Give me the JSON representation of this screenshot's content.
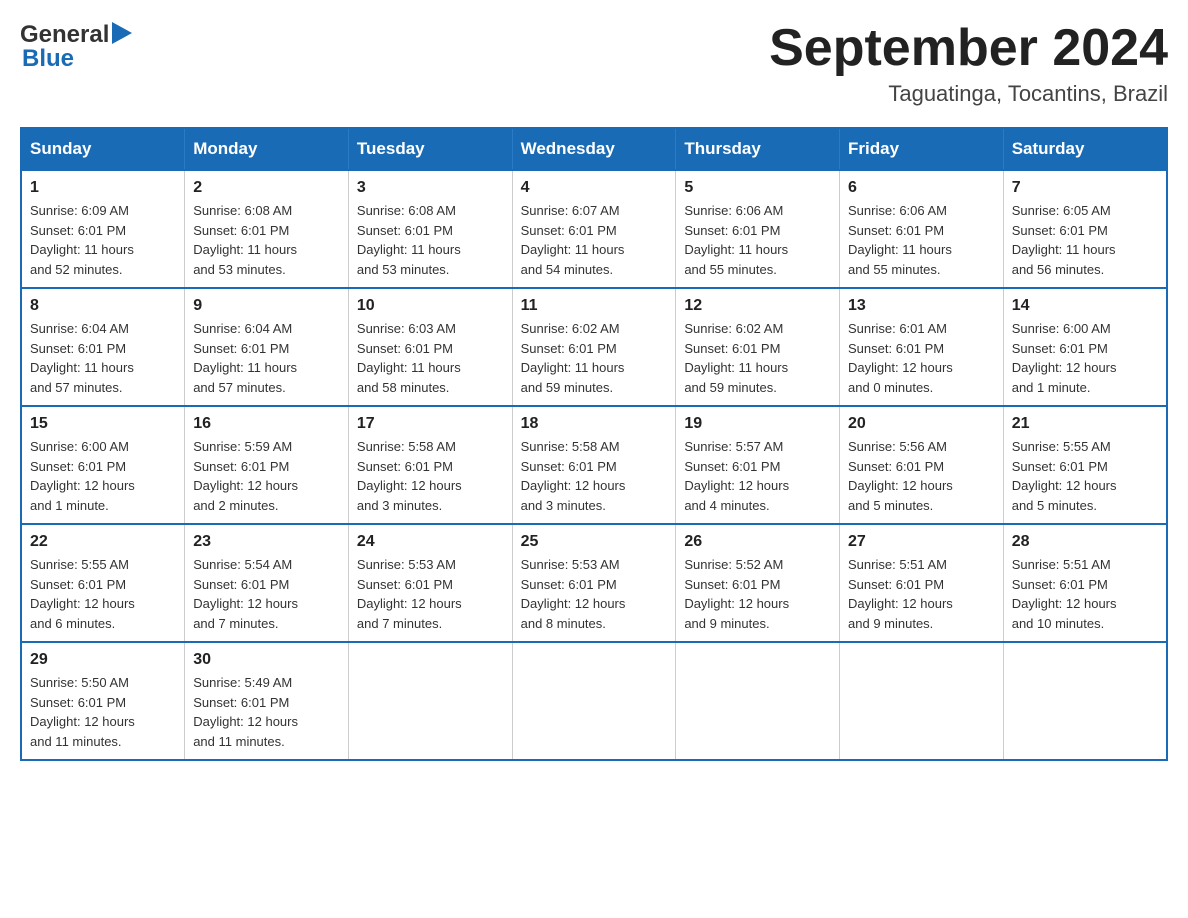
{
  "logo": {
    "text_general": "General",
    "triangle": "▶",
    "text_blue": "Blue"
  },
  "title": "September 2024",
  "subtitle": "Taguatinga, Tocantins, Brazil",
  "headers": [
    "Sunday",
    "Monday",
    "Tuesday",
    "Wednesday",
    "Thursday",
    "Friday",
    "Saturday"
  ],
  "weeks": [
    [
      {
        "day": "1",
        "info": "Sunrise: 6:09 AM\nSunset: 6:01 PM\nDaylight: 11 hours\nand 52 minutes."
      },
      {
        "day": "2",
        "info": "Sunrise: 6:08 AM\nSunset: 6:01 PM\nDaylight: 11 hours\nand 53 minutes."
      },
      {
        "day": "3",
        "info": "Sunrise: 6:08 AM\nSunset: 6:01 PM\nDaylight: 11 hours\nand 53 minutes."
      },
      {
        "day": "4",
        "info": "Sunrise: 6:07 AM\nSunset: 6:01 PM\nDaylight: 11 hours\nand 54 minutes."
      },
      {
        "day": "5",
        "info": "Sunrise: 6:06 AM\nSunset: 6:01 PM\nDaylight: 11 hours\nand 55 minutes."
      },
      {
        "day": "6",
        "info": "Sunrise: 6:06 AM\nSunset: 6:01 PM\nDaylight: 11 hours\nand 55 minutes."
      },
      {
        "day": "7",
        "info": "Sunrise: 6:05 AM\nSunset: 6:01 PM\nDaylight: 11 hours\nand 56 minutes."
      }
    ],
    [
      {
        "day": "8",
        "info": "Sunrise: 6:04 AM\nSunset: 6:01 PM\nDaylight: 11 hours\nand 57 minutes."
      },
      {
        "day": "9",
        "info": "Sunrise: 6:04 AM\nSunset: 6:01 PM\nDaylight: 11 hours\nand 57 minutes."
      },
      {
        "day": "10",
        "info": "Sunrise: 6:03 AM\nSunset: 6:01 PM\nDaylight: 11 hours\nand 58 minutes."
      },
      {
        "day": "11",
        "info": "Sunrise: 6:02 AM\nSunset: 6:01 PM\nDaylight: 11 hours\nand 59 minutes."
      },
      {
        "day": "12",
        "info": "Sunrise: 6:02 AM\nSunset: 6:01 PM\nDaylight: 11 hours\nand 59 minutes."
      },
      {
        "day": "13",
        "info": "Sunrise: 6:01 AM\nSunset: 6:01 PM\nDaylight: 12 hours\nand 0 minutes."
      },
      {
        "day": "14",
        "info": "Sunrise: 6:00 AM\nSunset: 6:01 PM\nDaylight: 12 hours\nand 1 minute."
      }
    ],
    [
      {
        "day": "15",
        "info": "Sunrise: 6:00 AM\nSunset: 6:01 PM\nDaylight: 12 hours\nand 1 minute."
      },
      {
        "day": "16",
        "info": "Sunrise: 5:59 AM\nSunset: 6:01 PM\nDaylight: 12 hours\nand 2 minutes."
      },
      {
        "day": "17",
        "info": "Sunrise: 5:58 AM\nSunset: 6:01 PM\nDaylight: 12 hours\nand 3 minutes."
      },
      {
        "day": "18",
        "info": "Sunrise: 5:58 AM\nSunset: 6:01 PM\nDaylight: 12 hours\nand 3 minutes."
      },
      {
        "day": "19",
        "info": "Sunrise: 5:57 AM\nSunset: 6:01 PM\nDaylight: 12 hours\nand 4 minutes."
      },
      {
        "day": "20",
        "info": "Sunrise: 5:56 AM\nSunset: 6:01 PM\nDaylight: 12 hours\nand 5 minutes."
      },
      {
        "day": "21",
        "info": "Sunrise: 5:55 AM\nSunset: 6:01 PM\nDaylight: 12 hours\nand 5 minutes."
      }
    ],
    [
      {
        "day": "22",
        "info": "Sunrise: 5:55 AM\nSunset: 6:01 PM\nDaylight: 12 hours\nand 6 minutes."
      },
      {
        "day": "23",
        "info": "Sunrise: 5:54 AM\nSunset: 6:01 PM\nDaylight: 12 hours\nand 7 minutes."
      },
      {
        "day": "24",
        "info": "Sunrise: 5:53 AM\nSunset: 6:01 PM\nDaylight: 12 hours\nand 7 minutes."
      },
      {
        "day": "25",
        "info": "Sunrise: 5:53 AM\nSunset: 6:01 PM\nDaylight: 12 hours\nand 8 minutes."
      },
      {
        "day": "26",
        "info": "Sunrise: 5:52 AM\nSunset: 6:01 PM\nDaylight: 12 hours\nand 9 minutes."
      },
      {
        "day": "27",
        "info": "Sunrise: 5:51 AM\nSunset: 6:01 PM\nDaylight: 12 hours\nand 9 minutes."
      },
      {
        "day": "28",
        "info": "Sunrise: 5:51 AM\nSunset: 6:01 PM\nDaylight: 12 hours\nand 10 minutes."
      }
    ],
    [
      {
        "day": "29",
        "info": "Sunrise: 5:50 AM\nSunset: 6:01 PM\nDaylight: 12 hours\nand 11 minutes."
      },
      {
        "day": "30",
        "info": "Sunrise: 5:49 AM\nSunset: 6:01 PM\nDaylight: 12 hours\nand 11 minutes."
      },
      {
        "day": "",
        "info": ""
      },
      {
        "day": "",
        "info": ""
      },
      {
        "day": "",
        "info": ""
      },
      {
        "day": "",
        "info": ""
      },
      {
        "day": "",
        "info": ""
      }
    ]
  ]
}
